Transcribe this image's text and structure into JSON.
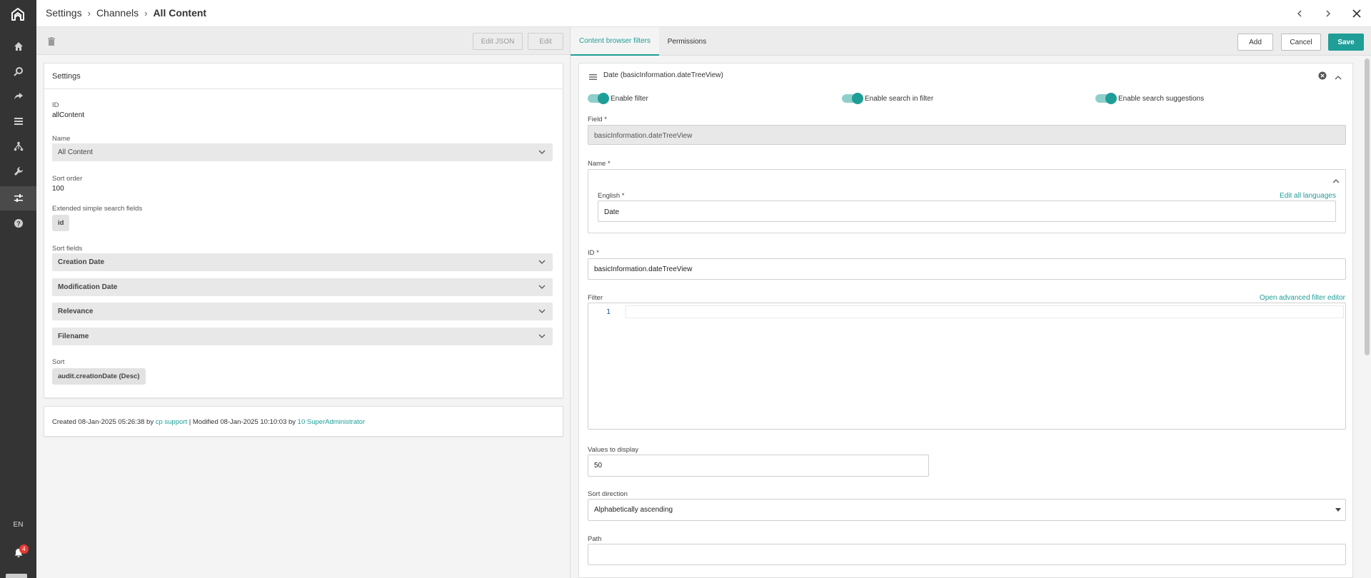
{
  "sidebar": {
    "icons": [
      "home-icon",
      "search-icon",
      "share-icon",
      "list-icon",
      "hierarchy-icon",
      "wrench-icon",
      "sliders-icon",
      "help-icon"
    ],
    "language": "EN",
    "notifications_count": "4"
  },
  "breadcrumb": {
    "items": [
      "Settings",
      "Channels",
      "All Content"
    ]
  },
  "left_toolbar": {
    "edit_json_label": "Edit JSON",
    "edit_label": "Edit"
  },
  "settings": {
    "title": "Settings",
    "id_label": "ID",
    "id_value": "allContent",
    "name_label": "Name",
    "name_value": "All Content",
    "sort_order_label": "Sort order",
    "sort_order_value": "100",
    "extended_label": "Extended simple search fields",
    "extended_chip": "id",
    "sort_fields_label": "Sort fields",
    "sort_fields": [
      "Creation Date",
      "Modification Date",
      "Relevance",
      "Filename"
    ],
    "sort_label": "Sort",
    "sort_chip": "audit.creationDate (Desc)"
  },
  "meta": {
    "created_prefix": "Created 08-Jan-2025 05:26:38 by ",
    "created_by": "cp support",
    "modified_prefix": " | Modified 08-Jan-2025 10:10:03 by ",
    "modified_by": "10 SuperAdministrator"
  },
  "right_toolbar": {
    "tabs": [
      "Content browser filters",
      "Permissions"
    ],
    "add_label": "Add",
    "cancel_label": "Cancel",
    "save_label": "Save"
  },
  "filter_panel": {
    "title": "Date (basicInformation.dateTreeView)",
    "toggles": [
      "Enable filter",
      "Enable search in filter",
      "Enable search suggestions"
    ],
    "field_label": "Field *",
    "field_value": "basicInformation.dateTreeView",
    "name_label": "Name *",
    "english_label": "English *",
    "edit_all_languages": "Edit all languages",
    "english_value": "Date",
    "id_label": "ID *",
    "id_value": "basicInformation.dateTreeView",
    "filter_label": "Filter",
    "advanced_link": "Open advanced filter editor",
    "line_number": "1",
    "values_label": "Values to display",
    "values_value": "50",
    "sort_direction_label": "Sort direction",
    "sort_direction_value": "Alphabetically ascending",
    "path_label": "Path",
    "path_value": ""
  },
  "colors": {
    "accent": "#1e9e97",
    "sidebar_bg": "#343434",
    "badge": "#e53935"
  }
}
